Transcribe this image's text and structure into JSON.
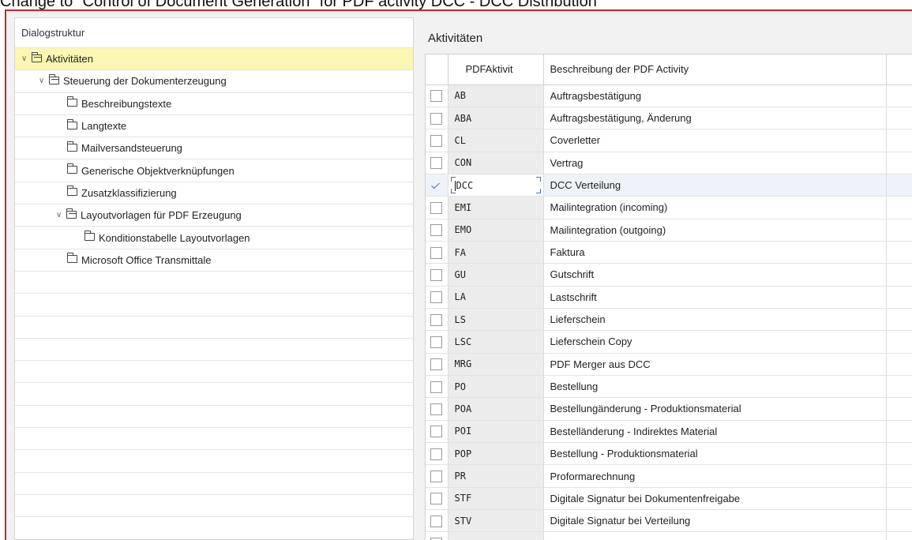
{
  "window_title": "Change to “Control of Document Generation” for PDF activity DCC - DCC Distribution",
  "dialog_structure": {
    "header": "Dialogstruktur",
    "items": [
      {
        "label": "Aktivitäten",
        "level": 0,
        "expanded": true,
        "selected": true
      },
      {
        "label": "Steuerung der Dokumenterzeugung",
        "level": 1,
        "expanded": true,
        "selected": false
      },
      {
        "label": "Beschreibungstexte",
        "level": 2,
        "expanded": null,
        "selected": false
      },
      {
        "label": "Langtexte",
        "level": 2,
        "expanded": null,
        "selected": false
      },
      {
        "label": "Mailversandsteuerung",
        "level": 2,
        "expanded": null,
        "selected": false
      },
      {
        "label": "Generische Objektverknüpfungen",
        "level": 2,
        "expanded": null,
        "selected": false
      },
      {
        "label": "Zusatzklassifizierung",
        "level": 2,
        "expanded": null,
        "selected": false
      },
      {
        "label": "Layoutvorlagen für PDF Erzeugung",
        "level": 2,
        "expanded": true,
        "selected": false
      },
      {
        "label": "Konditionstabelle Layoutvorlagen",
        "level": 3,
        "expanded": null,
        "selected": false
      },
      {
        "label": "Microsoft Office Transmittale",
        "level": 2,
        "expanded": null,
        "selected": false
      }
    ]
  },
  "activities": {
    "title": "Aktivitäten",
    "columns": [
      "PDFAktivit",
      "Beschreibung der PDF Activity"
    ],
    "rows": [
      {
        "code": "AB",
        "desc": "Auftragsbestätigung",
        "checked": false
      },
      {
        "code": "ABA",
        "desc": "Auftragsbestätigung, Änderung",
        "checked": false
      },
      {
        "code": "CL",
        "desc": "Coverletter",
        "checked": false
      },
      {
        "code": "CON",
        "desc": "Vertrag",
        "checked": false
      },
      {
        "code": "DCC",
        "desc": "DCC Verteilung",
        "checked": true
      },
      {
        "code": "EMI",
        "desc": "Mailintegration (incoming)",
        "checked": false
      },
      {
        "code": "EMO",
        "desc": "Mailintegration (outgoing)",
        "checked": false
      },
      {
        "code": "FA",
        "desc": "Faktura",
        "checked": false
      },
      {
        "code": "GU",
        "desc": "Gutschrift",
        "checked": false
      },
      {
        "code": "LA",
        "desc": "Lastschrift",
        "checked": false
      },
      {
        "code": "LS",
        "desc": "Lieferschein",
        "checked": false
      },
      {
        "code": "LSC",
        "desc": "Lieferschein Copy",
        "checked": false
      },
      {
        "code": "MRG",
        "desc": "PDF Merger aus DCC",
        "checked": false
      },
      {
        "code": "PO",
        "desc": "Bestellung",
        "checked": false
      },
      {
        "code": "POA",
        "desc": "Bestellungänderung - Produktionsmaterial",
        "checked": false
      },
      {
        "code": "POI",
        "desc": "Bestelländerung - Indirektes Material",
        "checked": false
      },
      {
        "code": "POP",
        "desc": "Bestellung - Produktionsmaterial",
        "checked": false
      },
      {
        "code": "PR",
        "desc": "Proformarechnung",
        "checked": false
      },
      {
        "code": "STF",
        "desc": "Digitale Signatur bei Dokumentenfreigabe",
        "checked": false
      },
      {
        "code": "STV",
        "desc": "Digitale Signatur bei Verteilung",
        "checked": false
      },
      {
        "code": "",
        "desc": "",
        "checked": false
      }
    ]
  }
}
